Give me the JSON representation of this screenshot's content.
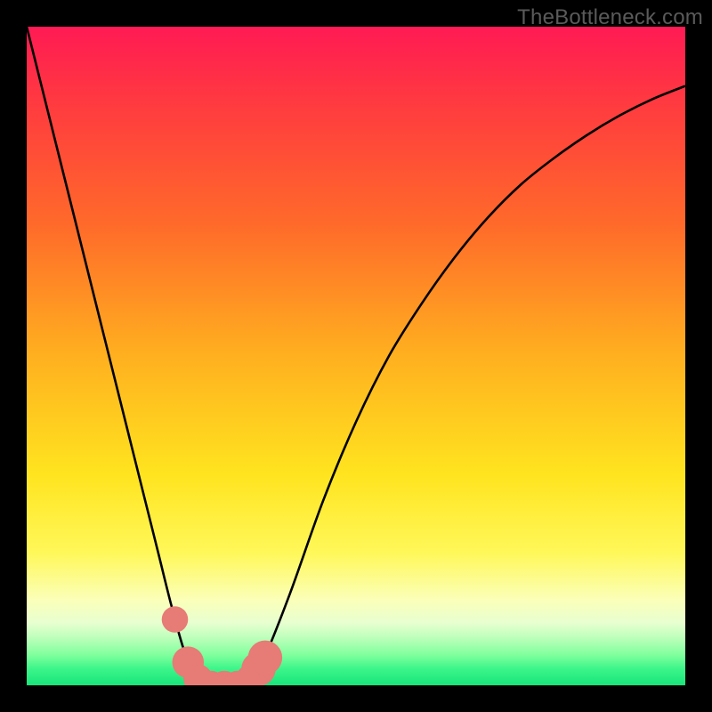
{
  "watermark": "TheBottleneck.com",
  "chart_data": {
    "type": "line",
    "title": "",
    "xlabel": "",
    "ylabel": "",
    "xlim": [
      0,
      100
    ],
    "ylim": [
      0,
      100
    ],
    "grid": false,
    "legend": false,
    "series": [
      {
        "name": "bottleneck-curve",
        "x": [
          0,
          5,
          10,
          15,
          18,
          20,
          22,
          24,
          26,
          28,
          30,
          32,
          34,
          36,
          40,
          45,
          50,
          55,
          60,
          65,
          70,
          75,
          80,
          85,
          90,
          95,
          100
        ],
        "y": [
          100,
          80,
          60,
          40,
          28,
          20,
          12,
          5,
          1,
          0,
          0,
          0,
          1,
          4,
          14,
          28,
          40,
          50,
          58,
          65,
          71,
          76,
          80,
          83.5,
          86.5,
          89,
          91
        ]
      }
    ],
    "markers": {
      "name": "highlight-points",
      "x": [
        22.5,
        24.5,
        26,
        28,
        30,
        32,
        34,
        35.2,
        36.2
      ],
      "y": [
        10,
        3.5,
        1,
        0,
        0,
        0,
        1,
        2.5,
        4.2
      ],
      "r": [
        2.0,
        2.4,
        2.2,
        2.2,
        2.2,
        2.2,
        2.2,
        2.6,
        2.6
      ]
    },
    "background_gradient": {
      "stops": [
        {
          "offset": 0.0,
          "color": "#ff1a54"
        },
        {
          "offset": 0.12,
          "color": "#ff3b3f"
        },
        {
          "offset": 0.3,
          "color": "#ff6a2a"
        },
        {
          "offset": 0.5,
          "color": "#ffb01f"
        },
        {
          "offset": 0.68,
          "color": "#ffe41f"
        },
        {
          "offset": 0.8,
          "color": "#fff85a"
        },
        {
          "offset": 0.87,
          "color": "#fbffb8"
        },
        {
          "offset": 0.905,
          "color": "#e8ffd0"
        },
        {
          "offset": 0.93,
          "color": "#b8ffb8"
        },
        {
          "offset": 0.955,
          "color": "#7dff9c"
        },
        {
          "offset": 0.975,
          "color": "#3cf58a"
        },
        {
          "offset": 1.0,
          "color": "#17e57a"
        }
      ]
    },
    "curve_stroke": "#000000",
    "marker_fill": "#e77b76"
  }
}
